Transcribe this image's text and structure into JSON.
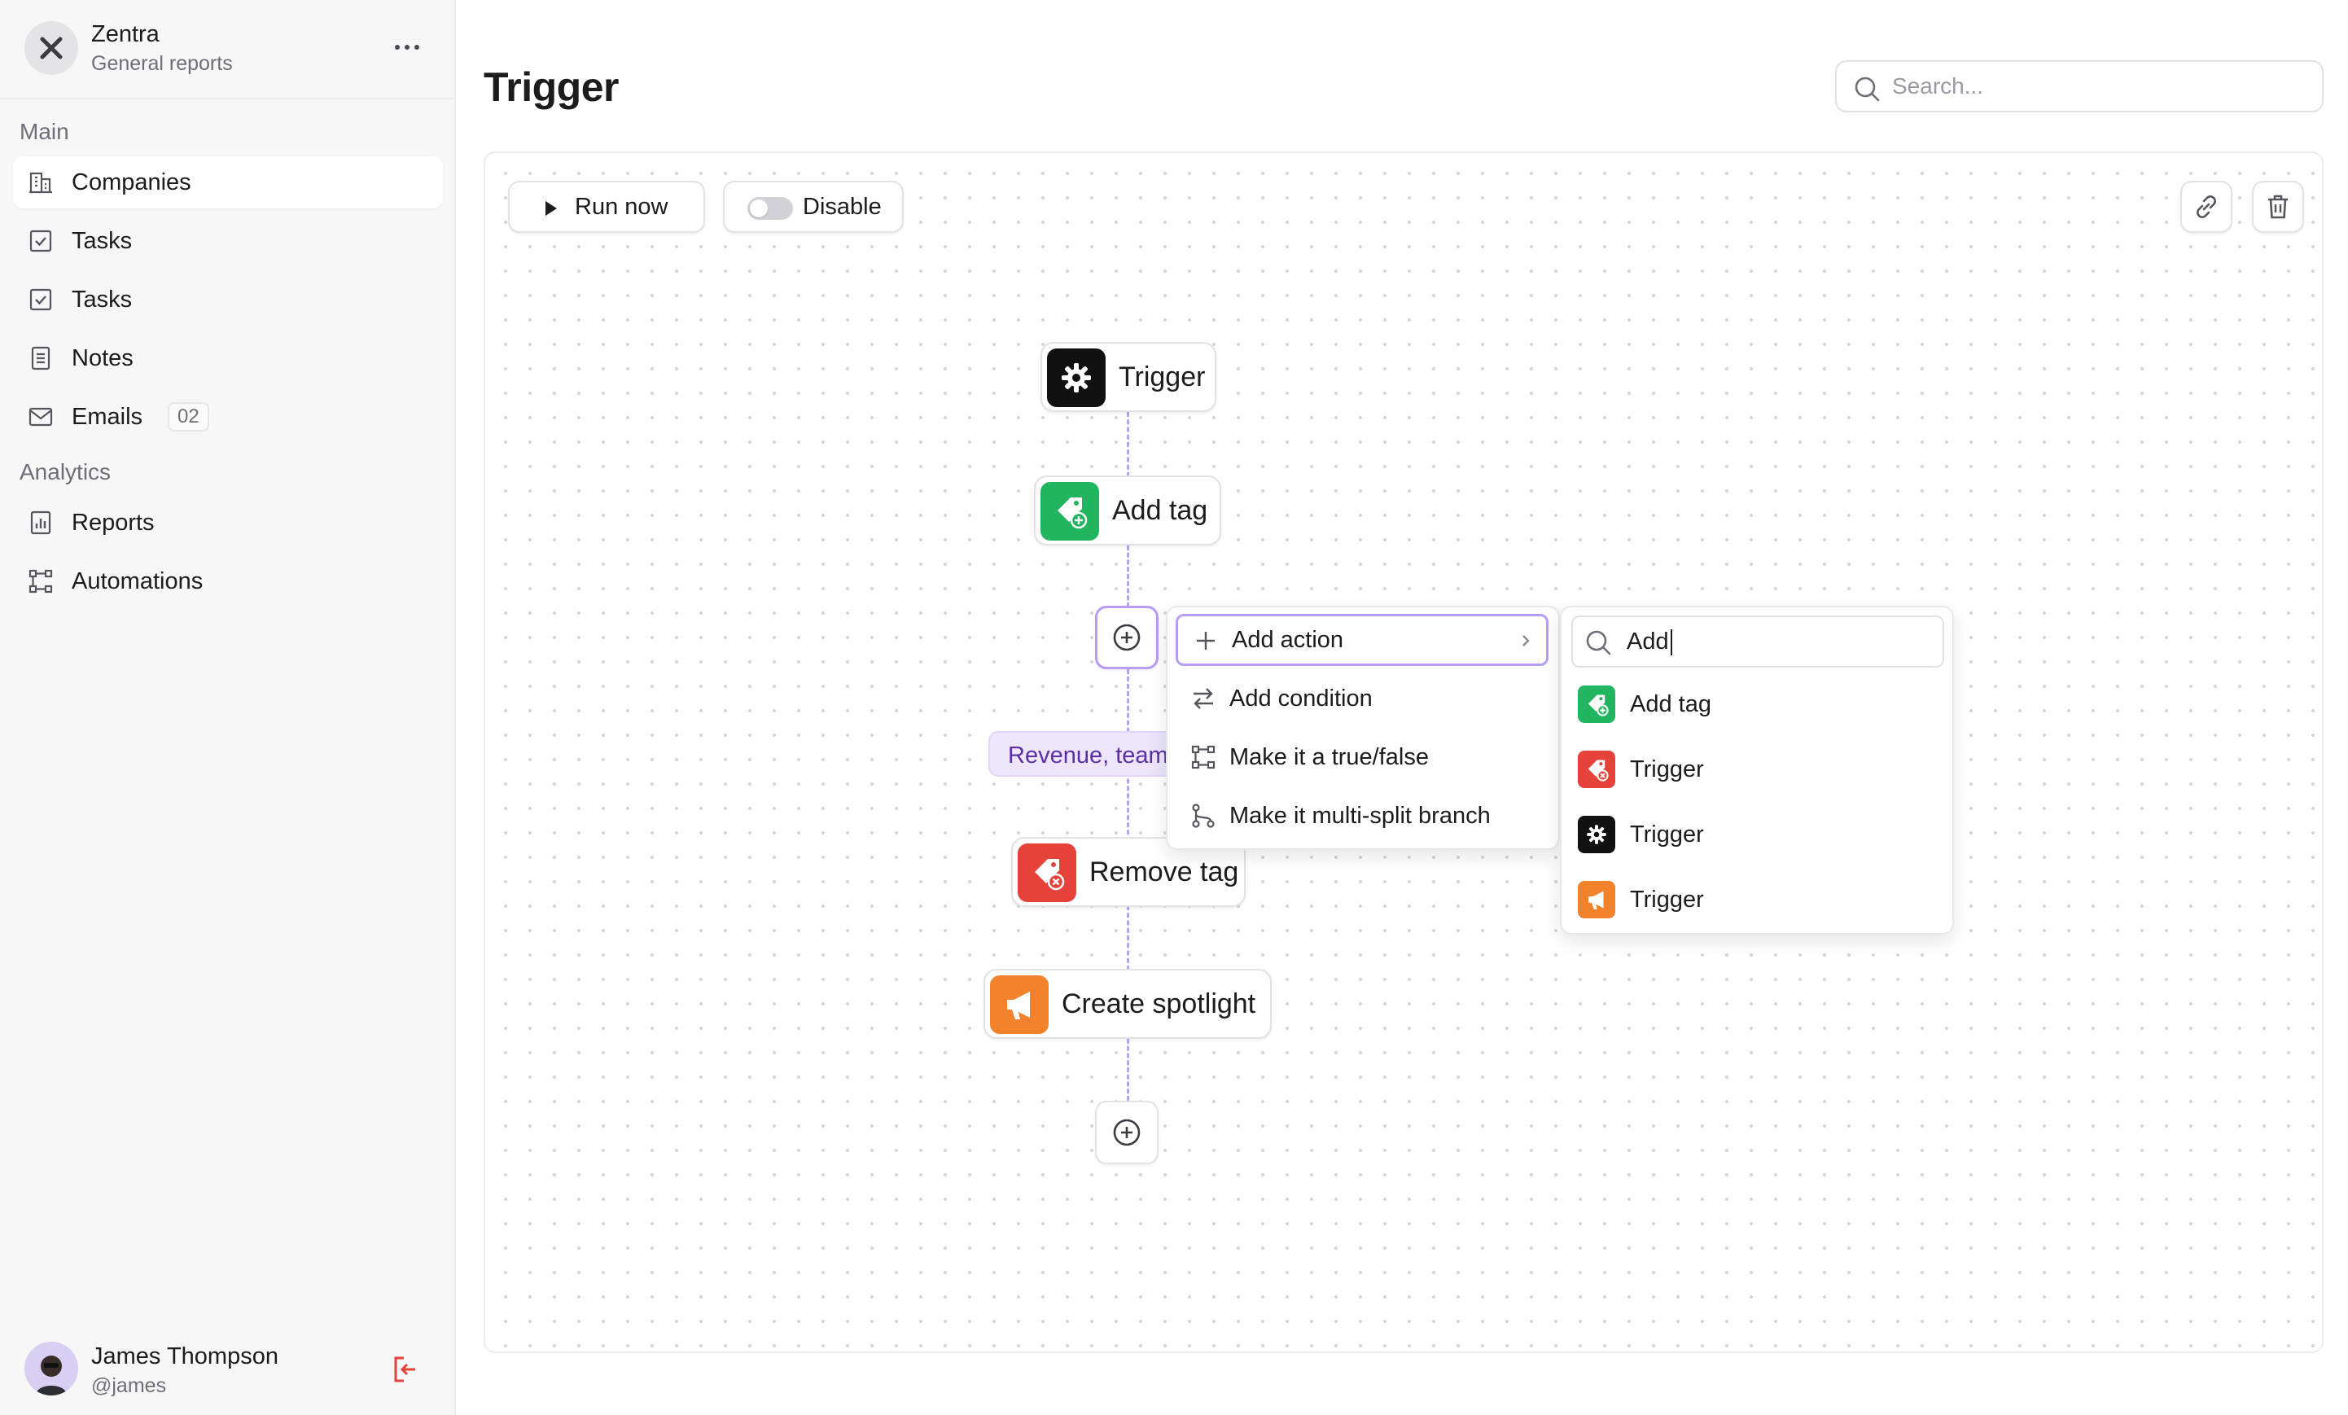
{
  "workspace": {
    "name": "Zentra",
    "subtitle": "General reports"
  },
  "nav": {
    "sections": [
      {
        "label": "Main"
      },
      {
        "label": "Analytics"
      }
    ],
    "items": [
      {
        "label": "Companies",
        "icon": "building-icon"
      },
      {
        "label": "Tasks",
        "icon": "checkbox-icon"
      },
      {
        "label": "Tasks",
        "icon": "checkbox-icon"
      },
      {
        "label": "Notes",
        "icon": "notes-icon"
      },
      {
        "label": "Emails",
        "icon": "mail-icon",
        "badge": "02"
      },
      {
        "label": "Reports",
        "icon": "report-icon"
      },
      {
        "label": "Automations",
        "icon": "automation-icon"
      }
    ]
  },
  "user": {
    "name": "James Thompson",
    "handle": "@james"
  },
  "page": {
    "title": "Trigger"
  },
  "search": {
    "placeholder": "Search..."
  },
  "toolbar": {
    "run_label": "Run now",
    "disable_label": "Disable"
  },
  "flow": {
    "nodes": [
      {
        "label": "Trigger",
        "icon": "gear-icon",
        "color": "#111111"
      },
      {
        "label": "Add tag",
        "icon": "tag-add-icon",
        "color": "#22b55f"
      },
      {
        "label": "Remove tag",
        "icon": "tag-remove-icon",
        "color": "#e5423a"
      },
      {
        "label": "Create spotlight",
        "icon": "megaphone-icon",
        "color": "#f2822b"
      }
    ],
    "branch_label": "Revenue, team"
  },
  "context_menu": {
    "items": [
      {
        "label": "Add action",
        "icon": "plus-icon"
      },
      {
        "label": "Add condition",
        "icon": "swap-icon"
      },
      {
        "label": "Make it a true/false",
        "icon": "branch-icon"
      },
      {
        "label": "Make it multi-split branch",
        "icon": "split-icon"
      }
    ]
  },
  "submenu": {
    "search_value": "Add",
    "results": [
      {
        "label": "Add tag",
        "icon": "tag-add-icon",
        "color": "#22b55f"
      },
      {
        "label": "Trigger",
        "icon": "tag-remove-icon",
        "color": "#e5423a"
      },
      {
        "label": "Trigger",
        "icon": "gear-icon",
        "color": "#111111"
      },
      {
        "label": "Trigger",
        "icon": "megaphone-icon",
        "color": "#f2822b"
      }
    ]
  },
  "colors": {
    "accent": "#b89cf5",
    "connector": "#b9a5ef",
    "branch_bg": "#ece5fc",
    "branch_text": "#5b2ea6"
  }
}
